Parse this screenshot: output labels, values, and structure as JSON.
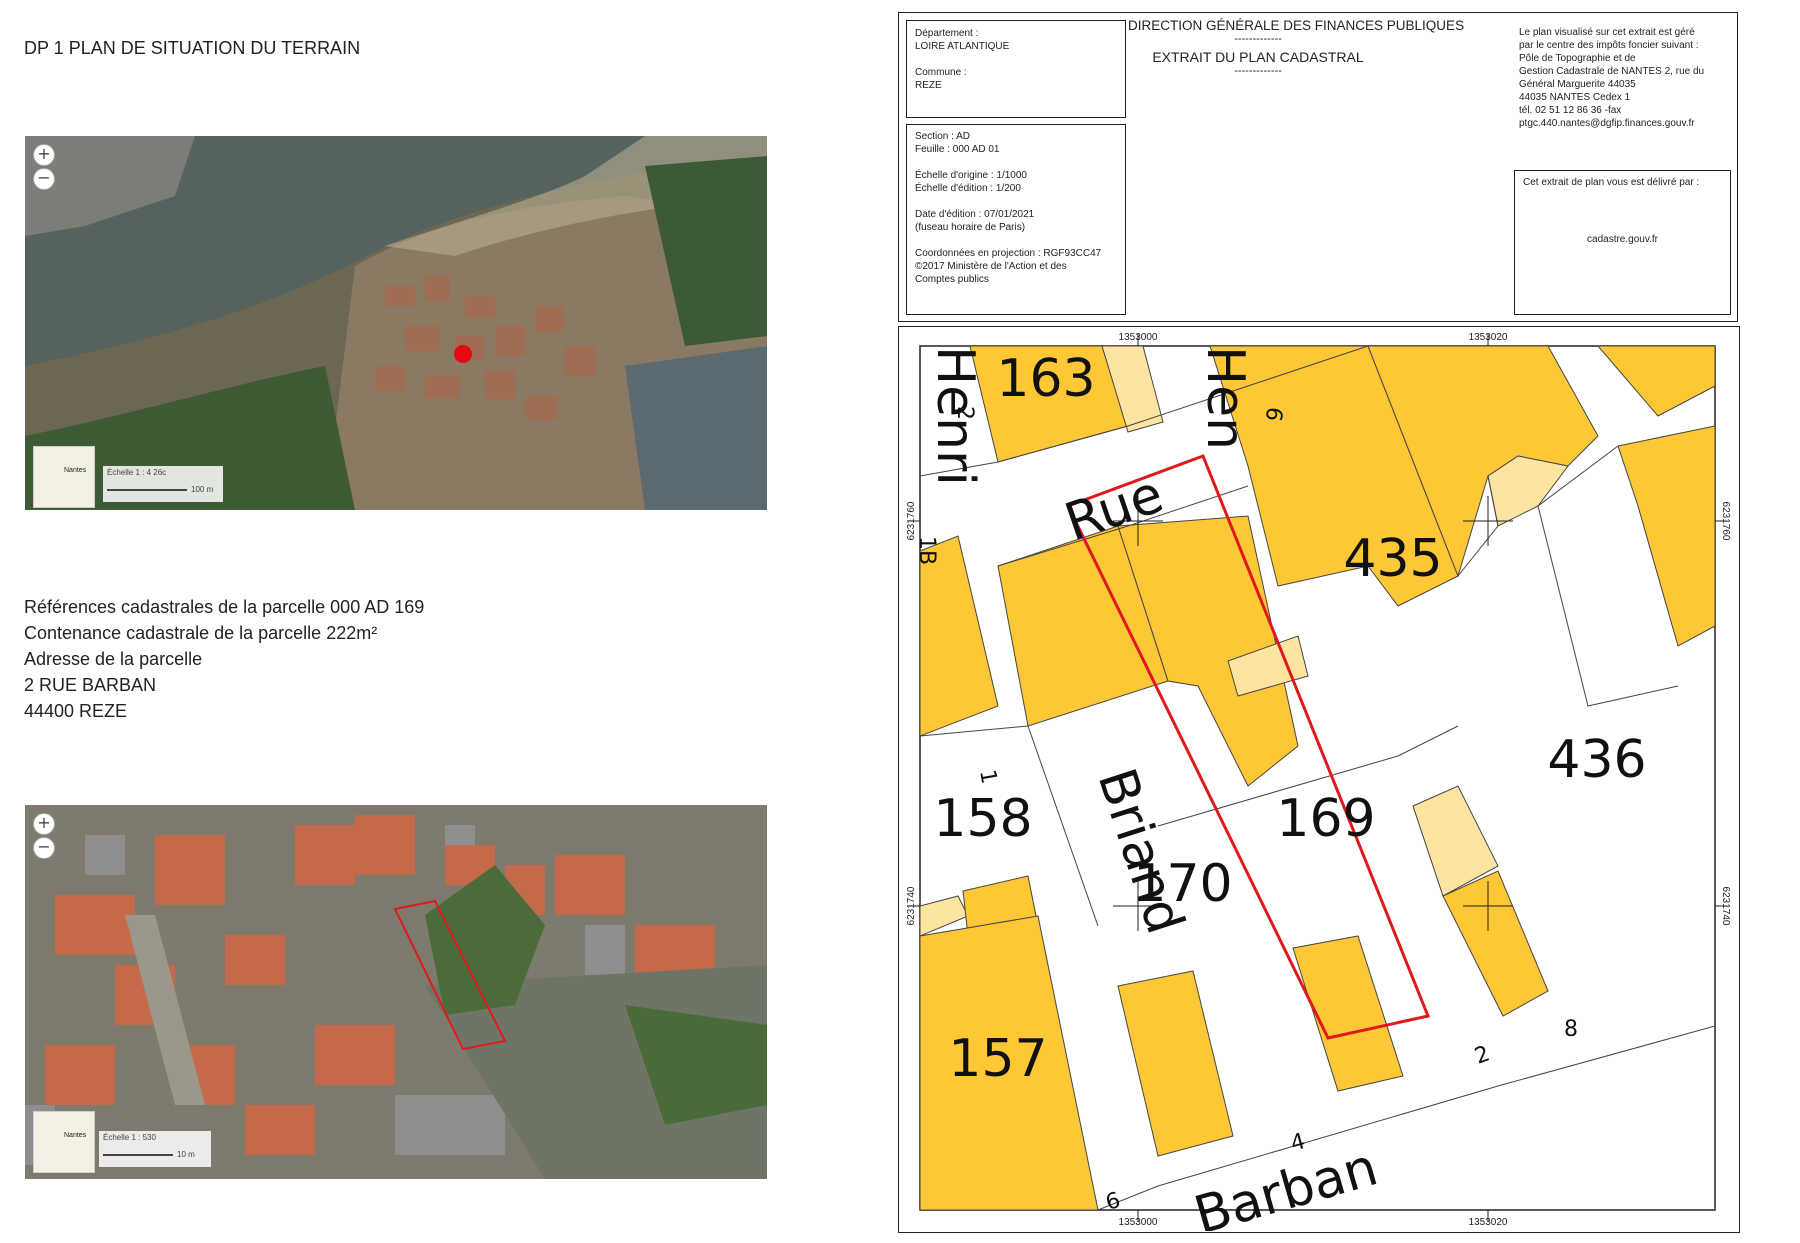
{
  "title": "DP 1 PLAN DE SITUATION DU TERRAIN",
  "aerial_top": {
    "zoom_in": "+",
    "zoom_out": "−",
    "scale_label": "Échelle 1 : 4 26c",
    "scale_bar_label": "100 m",
    "minimap_label": "Nantes"
  },
  "aerial_bottom": {
    "zoom_in": "+",
    "zoom_out": "−",
    "scale_label": "Échelle 1 : 530",
    "scale_bar_label": "10 m",
    "minimap_label": "Nantes"
  },
  "parcel_info": {
    "line1": "Références cadastrales de la parcelle 000 AD 169",
    "line2": "Contenance cadastrale de la parcelle 222m²",
    "line3": "Adresse de la parcelle",
    "line4": "2 RUE BARBAN",
    "line5": "44400 REZE"
  },
  "cadastre": {
    "box1": {
      "dep_label": "Département :",
      "dep_value": "LOIRE ATLANTIQUE",
      "commune_label": "Commune :",
      "commune_value": "REZE"
    },
    "header": {
      "l1": "DIRECTION GÉNÉRALE DES FINANCES PUBLIQUES",
      "l2": "-------------",
      "l3": "EXTRAIT DU PLAN CADASTRAL",
      "l4": "-------------"
    },
    "box3": {
      "l1": "Le plan visualisé sur cet extrait est géré",
      "l2": "par le centre des impôts foncier suivant :",
      "l3": "Pôle de Topographie et de",
      "l4": "Gestion Cadastrale de NANTES 2, rue du",
      "l5": "Général Marguerite 44035",
      "l6": "44035 NANTES Cedex 1",
      "l7": "tél. 02 51 12 86 36 -fax",
      "l8": "ptgc.440.nantes@dgfip.finances.gouv.fr"
    },
    "box2": {
      "l1": "Section : AD",
      "l2": "Feuille : 000 AD 01",
      "l3": "Échelle d'origine : 1/1000",
      "l4": "Échelle d'édition : 1/200",
      "l5": "Date d'édition : 07/01/2021",
      "l6": "(fuseau horaire de Paris)",
      "l7": "Coordonnées en projection : RGF93CC47",
      "l8": "©2017 Ministère de l'Action et des",
      "l9": "Comptes publics"
    },
    "box4": {
      "l1": "Cet extrait de plan vous est délivré par :",
      "l2": "cadastre.gouv.fr"
    },
    "map": {
      "coord_top_1": "1353000",
      "coord_top_2": "1353020",
      "coord_bottom_1": "1353000",
      "coord_bottom_2": "1353020",
      "coord_left_1": "6231760",
      "coord_left_2": "6231740",
      "coord_right_1": "6231760",
      "coord_right_2": "6231740",
      "parcels": [
        "163",
        "435",
        "436",
        "158",
        "169",
        "170",
        "157"
      ],
      "streets": {
        "rue": "Rue",
        "briand": "Briand",
        "barban": "Barban",
        "henri": "Henri",
        "hen": "Hen"
      },
      "numbers": {
        "n6": "6",
        "n1": "1",
        "n8": "8",
        "n2": "2",
        "n4": "4",
        "n1b": "1B",
        "n2b": "2",
        "n6b": "6"
      }
    }
  },
  "colors": {
    "building": "#fdc735",
    "building_light": "#fde4a0",
    "parcel_outline": "#e0191b",
    "water": "#5e6e6a",
    "marker": "#e50914"
  }
}
